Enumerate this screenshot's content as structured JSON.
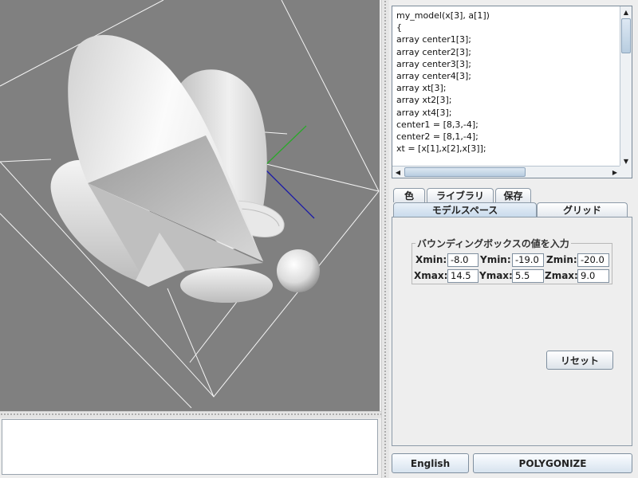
{
  "code_editor": {
    "lines": [
      "my_model(x[3], a[1])",
      "{",
      "array center1[3];",
      "array center2[3];",
      "array center3[3];",
      "array center4[3];",
      "array xt[3];",
      "array xt2[3];",
      "array xt4[3];",
      "center1 = [8,3,-4];",
      "center2 = [8,1,-4];",
      "xt = [x[1],x[2],x[3]];"
    ]
  },
  "tabs": {
    "row1": [
      "色",
      "ライブラリ",
      "保存"
    ],
    "row2": [
      "モデルスペース",
      "グリッド"
    ],
    "active": "モデルスペース"
  },
  "bounding_box": {
    "legend": "バウンディングボックスの値を入力",
    "xmin_label": "Xmin:",
    "xmin": "-8.0",
    "ymin_label": "Ymin:",
    "ymin": "-19.0",
    "zmin_label": "Zmin:",
    "zmin": "-20.0",
    "xmax_label": "Xmax:",
    "xmax": "14.5",
    "ymax_label": "Ymax:",
    "ymax": "5.5",
    "zmax_label": "Zmax:",
    "zmax": "9.0"
  },
  "buttons": {
    "reset": "リセット",
    "language": "English",
    "polygonize": "POLYGONIZE"
  },
  "colors": {
    "viewport_bg": "#808080",
    "axis_x": "#1a1aa8",
    "axis_y": "#2aa82a"
  }
}
